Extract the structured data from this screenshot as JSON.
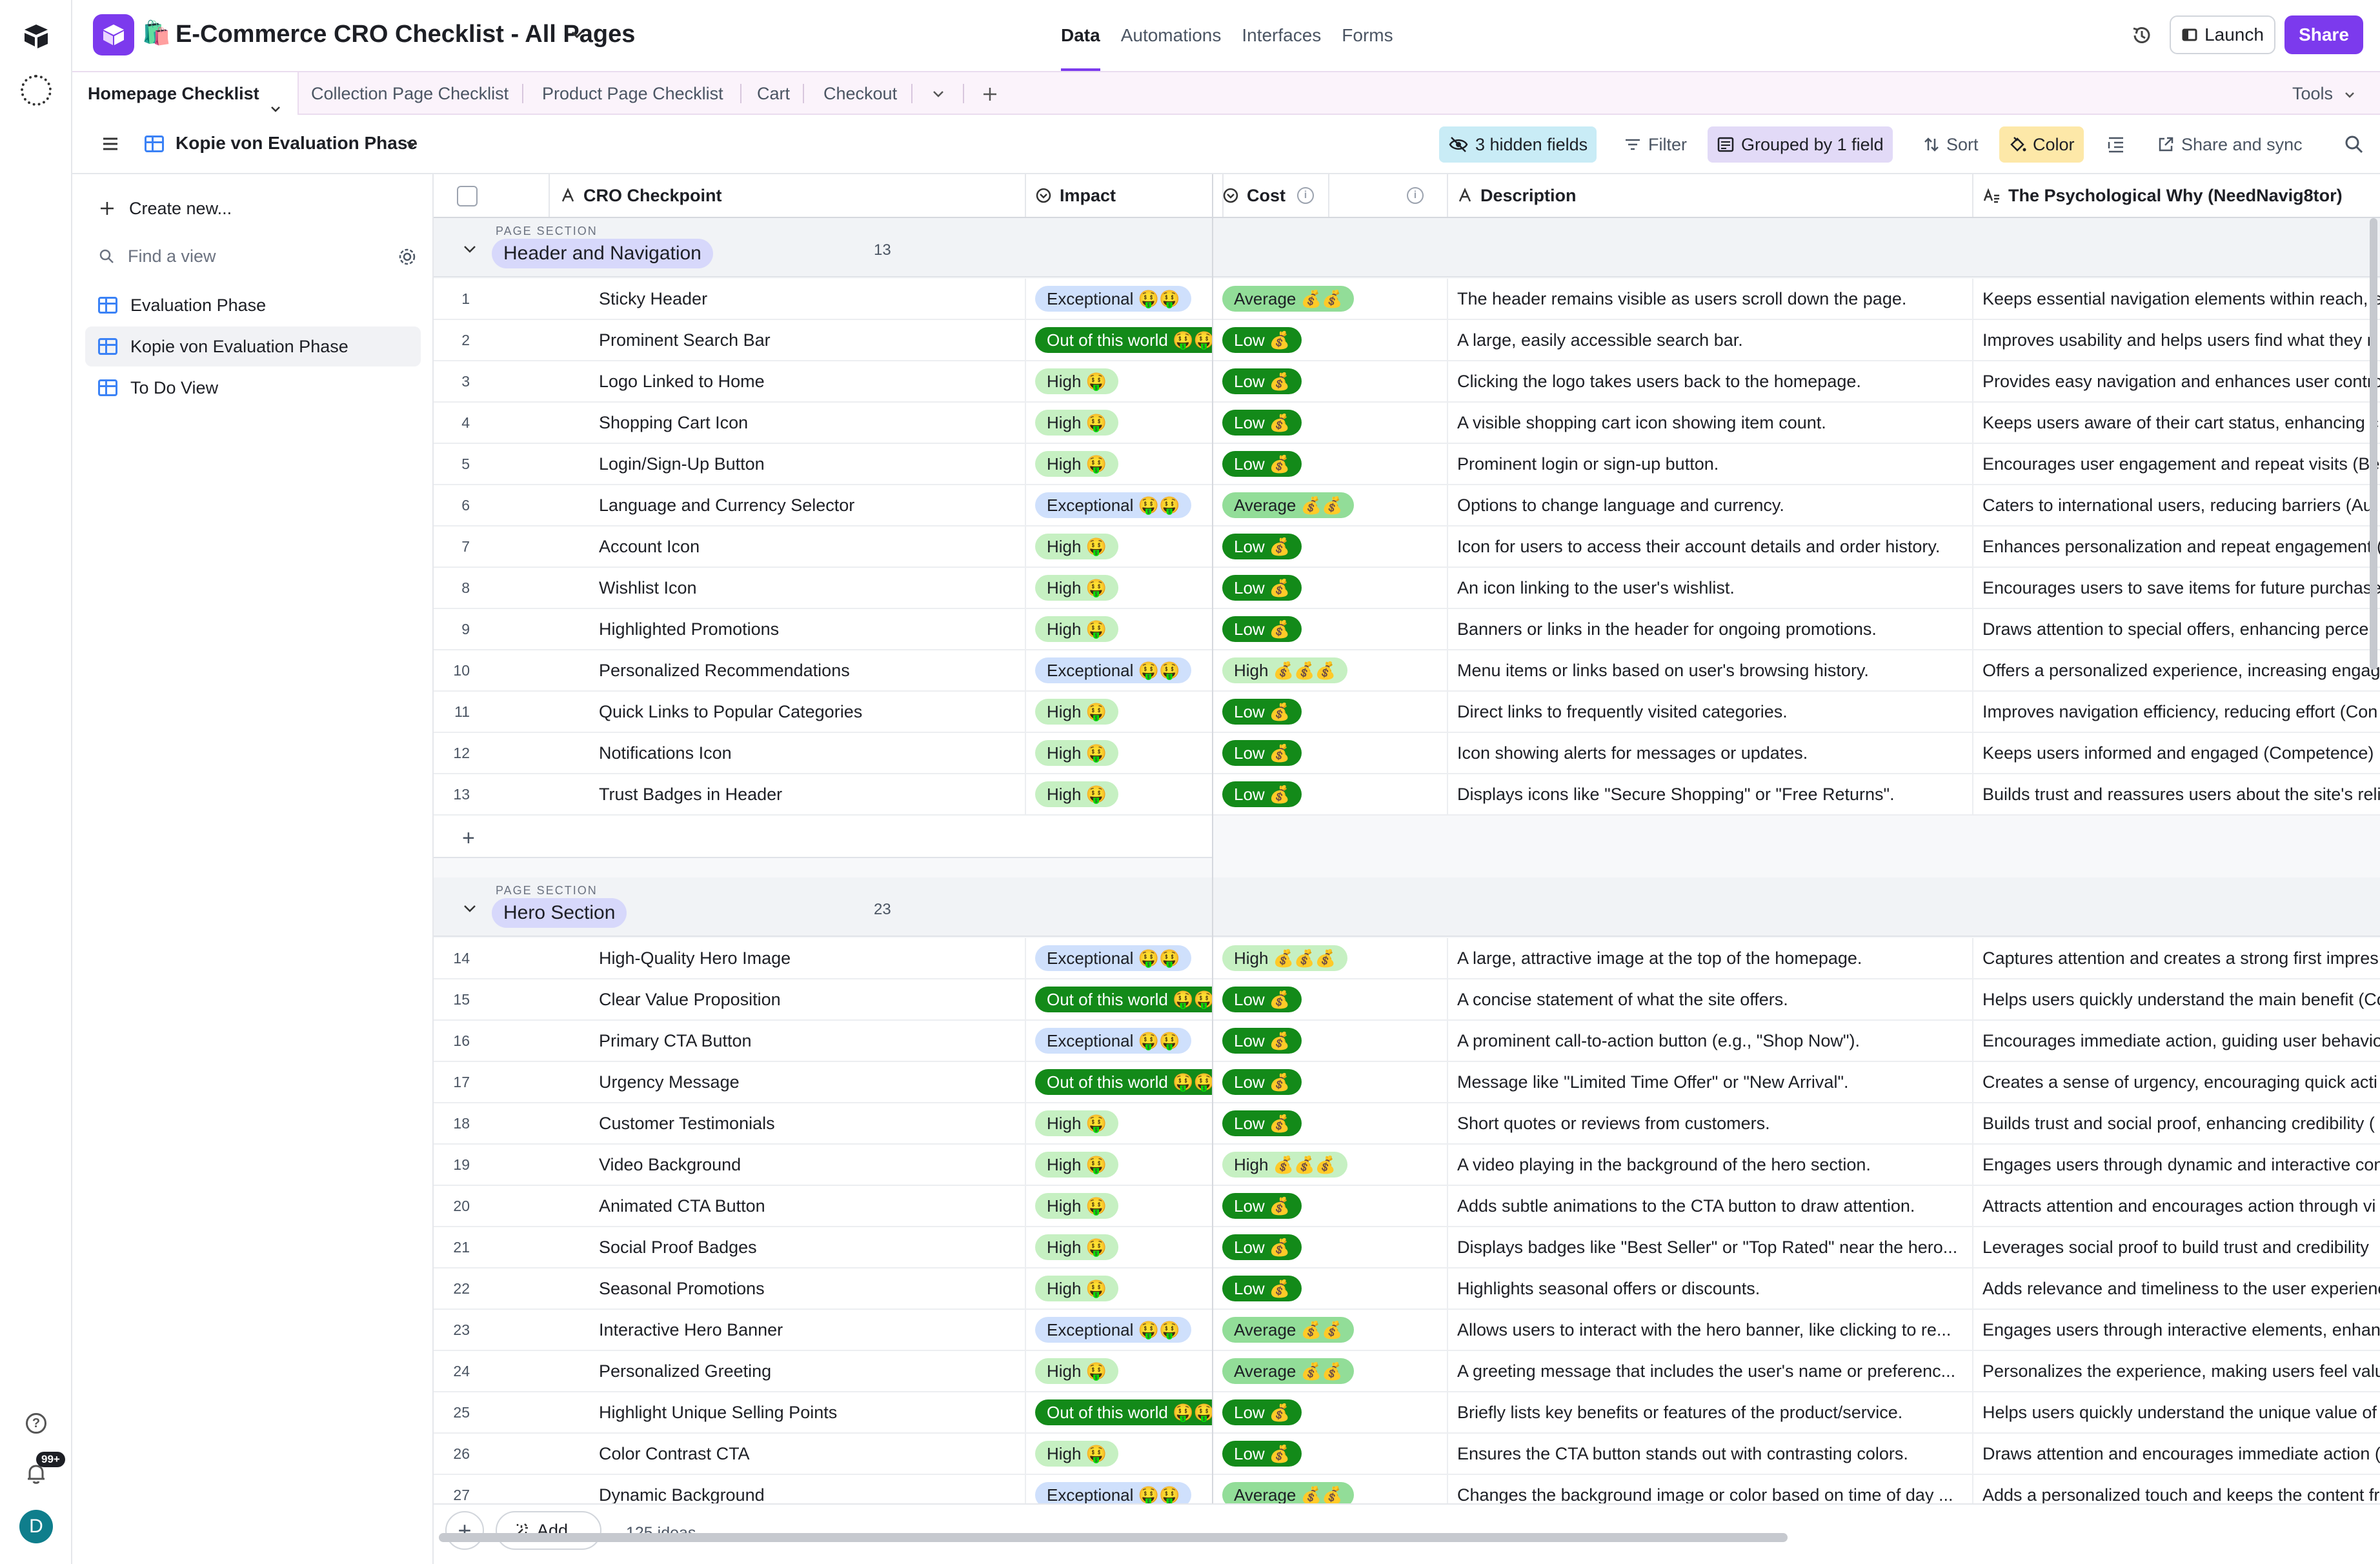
{
  "app": {
    "base_title": "E-Commerce CRO Checklist - All Pages",
    "base_emoji": "🛍️",
    "nav": [
      "Data",
      "Automations",
      "Interfaces",
      "Forms"
    ],
    "launch": "Launch",
    "share": "Share",
    "notif_badge": "99+",
    "avatar_initial": "D",
    "accent": "#7c3aed"
  },
  "tables": {
    "active": "Homepage Checklist",
    "others": [
      "Collection Page Checklist",
      "Product Page Checklist",
      "Cart",
      "Checkout"
    ],
    "tools": "Tools"
  },
  "toolbar": {
    "view_name": "Kopie von Evaluation Phase",
    "hidden_fields": "3 hidden fields",
    "filter": "Filter",
    "grouped": "Grouped by 1 field",
    "sort": "Sort",
    "color": "Color",
    "share_sync": "Share and sync"
  },
  "sidebar": {
    "create_new": "Create new...",
    "find_placeholder": "Find a view",
    "views": [
      "Evaluation Phase",
      "Kopie von Evaluation Phase",
      "To Do View"
    ]
  },
  "columns": {
    "checkpoint": "CRO Checkpoint",
    "impact": "Impact",
    "cost": "Cost",
    "description": "Description",
    "why": "The Psychological Why (NeedNavig8tor)"
  },
  "groups": [
    {
      "label": "PAGE SECTION",
      "name": "Header and Navigation",
      "count": "13",
      "rows": [
        {
          "n": "1",
          "checkpoint": "Sticky Header",
          "impact": "Exceptional 🤑🤑",
          "impact_type": "exceptional",
          "cost": "Average 💰💰",
          "cost_type": "avg",
          "description": "The header remains visible as users scroll down the page.",
          "why": "Keeps essential navigation elements within reach, e"
        },
        {
          "n": "2",
          "checkpoint": "Prominent Search Bar",
          "impact": "Out of this world 🤑🤑🤑",
          "impact_type": "otw",
          "cost": "Low 💰",
          "cost_type": "low",
          "description": "A large, easily accessible search bar.",
          "why": "Improves usability and helps users find what they n"
        },
        {
          "n": "3",
          "checkpoint": "Logo Linked to Home",
          "impact": "High 🤑",
          "impact_type": "high",
          "cost": "Low 💰",
          "cost_type": "low",
          "description": "Clicking the logo takes users back to the homepage.",
          "why": "Provides easy navigation and enhances user contro"
        },
        {
          "n": "4",
          "checkpoint": "Shopping Cart Icon",
          "impact": "High 🤑",
          "impact_type": "high",
          "cost": "Low 💰",
          "cost_type": "low",
          "description": "A visible shopping cart icon showing item count.",
          "why": "Keeps users aware of their cart status, enhancing c"
        },
        {
          "n": "5",
          "checkpoint": "Login/Sign-Up Button",
          "impact": "High 🤑",
          "impact_type": "high",
          "cost": "Low 💰",
          "cost_type": "low",
          "description": "Prominent login or sign-up button.",
          "why": "Encourages user engagement and repeat visits (Be"
        },
        {
          "n": "6",
          "checkpoint": "Language and Currency Selector",
          "impact": "Exceptional 🤑🤑",
          "impact_type": "exceptional",
          "cost": "Average 💰💰",
          "cost_type": "avg",
          "description": "Options to change language and currency.",
          "why": "Caters to international users, reducing barriers (Aut"
        },
        {
          "n": "7",
          "checkpoint": "Account Icon",
          "impact": "High 🤑",
          "impact_type": "high",
          "cost": "Low 💰",
          "cost_type": "low",
          "description": "Icon for users to access their account details and order history.",
          "why": "Enhances personalization and repeat engagement ("
        },
        {
          "n": "8",
          "checkpoint": "Wishlist Icon",
          "impact": "High 🤑",
          "impact_type": "high",
          "cost": "Low 💰",
          "cost_type": "low",
          "description": "An icon linking to the user's wishlist.",
          "why": "Encourages users to save items for future purchase"
        },
        {
          "n": "9",
          "checkpoint": "Highlighted Promotions",
          "impact": "High 🤑",
          "impact_type": "high",
          "cost": "Low 💰",
          "cost_type": "low",
          "description": "Banners or links in the header for ongoing promotions.",
          "why": "Draws attention to special offers, enhancing percei"
        },
        {
          "n": "10",
          "checkpoint": "Personalized Recommendations",
          "impact": "Exceptional 🤑🤑",
          "impact_type": "exceptional",
          "cost": "High 💰💰💰",
          "cost_type": "highcost",
          "description": "Menu items or links based on user's browsing history.",
          "why": "Offers a personalized experience, increasing engag"
        },
        {
          "n": "11",
          "checkpoint": "Quick Links to Popular Categories",
          "impact": "High 🤑",
          "impact_type": "high",
          "cost": "Low 💰",
          "cost_type": "low",
          "description": "Direct links to frequently visited categories.",
          "why": "Improves navigation efficiency, reducing effort (Con"
        },
        {
          "n": "12",
          "checkpoint": "Notifications Icon",
          "impact": "High 🤑",
          "impact_type": "high",
          "cost": "Low 💰",
          "cost_type": "low",
          "description": "Icon showing alerts for messages or updates.",
          "why": "Keeps users informed and engaged (Competence)"
        },
        {
          "n": "13",
          "checkpoint": "Trust Badges in Header",
          "impact": "High 🤑",
          "impact_type": "high",
          "cost": "Low 💰",
          "cost_type": "low",
          "description": "Displays icons like \"Secure Shopping\" or \"Free Returns\".",
          "why": "Builds trust and reassures users about the site's reli"
        }
      ]
    },
    {
      "label": "PAGE SECTION",
      "name": "Hero Section",
      "count": "23",
      "rows": [
        {
          "n": "14",
          "checkpoint": "High-Quality Hero Image",
          "impact": "Exceptional 🤑🤑",
          "impact_type": "exceptional",
          "cost": "High 💰💰💰",
          "cost_type": "highcost",
          "description": "A large, attractive image at the top of the homepage.",
          "why": "Captures attention and creates a strong first impres"
        },
        {
          "n": "15",
          "checkpoint": "Clear Value Proposition",
          "impact": "Out of this world 🤑🤑🤑",
          "impact_type": "otw",
          "cost": "Low 💰",
          "cost_type": "low",
          "description": "A concise statement of what the site offers.",
          "why": "Helps users quickly understand the main benefit (Co"
        },
        {
          "n": "16",
          "checkpoint": "Primary CTA Button",
          "impact": "Exceptional 🤑🤑",
          "impact_type": "exceptional",
          "cost": "Low 💰",
          "cost_type": "low",
          "description": "A prominent call-to-action button (e.g., \"Shop Now\").",
          "why": "Encourages immediate action, guiding user behavio"
        },
        {
          "n": "17",
          "checkpoint": "Urgency Message",
          "impact": "Out of this world 🤑🤑🤑",
          "impact_type": "otw",
          "cost": "Low 💰",
          "cost_type": "low",
          "description": "Message like \"Limited Time Offer\" or \"New Arrival\".",
          "why": "Creates a sense of urgency, encouraging quick acti"
        },
        {
          "n": "18",
          "checkpoint": "Customer Testimonials",
          "impact": "High 🤑",
          "impact_type": "high",
          "cost": "Low 💰",
          "cost_type": "low",
          "description": "Short quotes or reviews from customers.",
          "why": "Builds trust and social proof, enhancing credibility ("
        },
        {
          "n": "19",
          "checkpoint": "Video Background",
          "impact": "High 🤑",
          "impact_type": "high",
          "cost": "High 💰💰💰",
          "cost_type": "highcost",
          "description": "A video playing in the background of the hero section.",
          "why": "Engages users through dynamic and interactive con"
        },
        {
          "n": "20",
          "checkpoint": "Animated CTA Button",
          "impact": "High 🤑",
          "impact_type": "high",
          "cost": "Low 💰",
          "cost_type": "low",
          "description": "Adds subtle animations to the CTA button to draw attention.",
          "why": "Attracts attention and encourages action through vi"
        },
        {
          "n": "21",
          "checkpoint": "Social Proof Badges",
          "impact": "High 🤑",
          "impact_type": "high",
          "cost": "Low 💰",
          "cost_type": "low",
          "description": "Displays badges like \"Best Seller\" or \"Top Rated\" near the hero...",
          "why": "Leverages social proof to build trust and credibility"
        },
        {
          "n": "22",
          "checkpoint": "Seasonal Promotions",
          "impact": "High 🤑",
          "impact_type": "high",
          "cost": "Low 💰",
          "cost_type": "low",
          "description": "Highlights seasonal offers or discounts.",
          "why": "Adds relevance and timeliness to the user experienc"
        },
        {
          "n": "23",
          "checkpoint": "Interactive Hero Banner",
          "impact": "Exceptional 🤑🤑",
          "impact_type": "exceptional",
          "cost": "Average 💰💰",
          "cost_type": "avg",
          "description": "Allows users to interact with the hero banner, like clicking to re...",
          "why": "Engages users through interactive elements, enhan"
        },
        {
          "n": "24",
          "checkpoint": "Personalized Greeting",
          "impact": "High 🤑",
          "impact_type": "high",
          "cost": "Average 💰💰",
          "cost_type": "avg",
          "description": "A greeting message that includes the user's name or preferenc...",
          "why": "Personalizes the experience, making users feel valu"
        },
        {
          "n": "25",
          "checkpoint": "Highlight Unique Selling Points",
          "impact": "Out of this world 🤑🤑🤑",
          "impact_type": "otw",
          "cost": "Low 💰",
          "cost_type": "low",
          "description": "Briefly lists key benefits or features of the product/service.",
          "why": "Helps users quickly understand the unique value of"
        },
        {
          "n": "26",
          "checkpoint": "Color Contrast CTA",
          "impact": "High 🤑",
          "impact_type": "high",
          "cost": "Low 💰",
          "cost_type": "low",
          "description": "Ensures the CTA button stands out with contrasting colors.",
          "why": "Draws attention and encourages immediate action ("
        },
        {
          "n": "27",
          "checkpoint": "Dynamic Background",
          "impact": "Exceptional 🤑🤑",
          "impact_type": "exceptional",
          "cost": "Average 💰💰",
          "cost_type": "avg",
          "description": "Changes the background image or color based on time of day ...",
          "why": "Adds a personalized touch and keeps the content fr"
        }
      ]
    }
  ],
  "footer": {
    "add": "Add...",
    "count": "125 ideas"
  }
}
